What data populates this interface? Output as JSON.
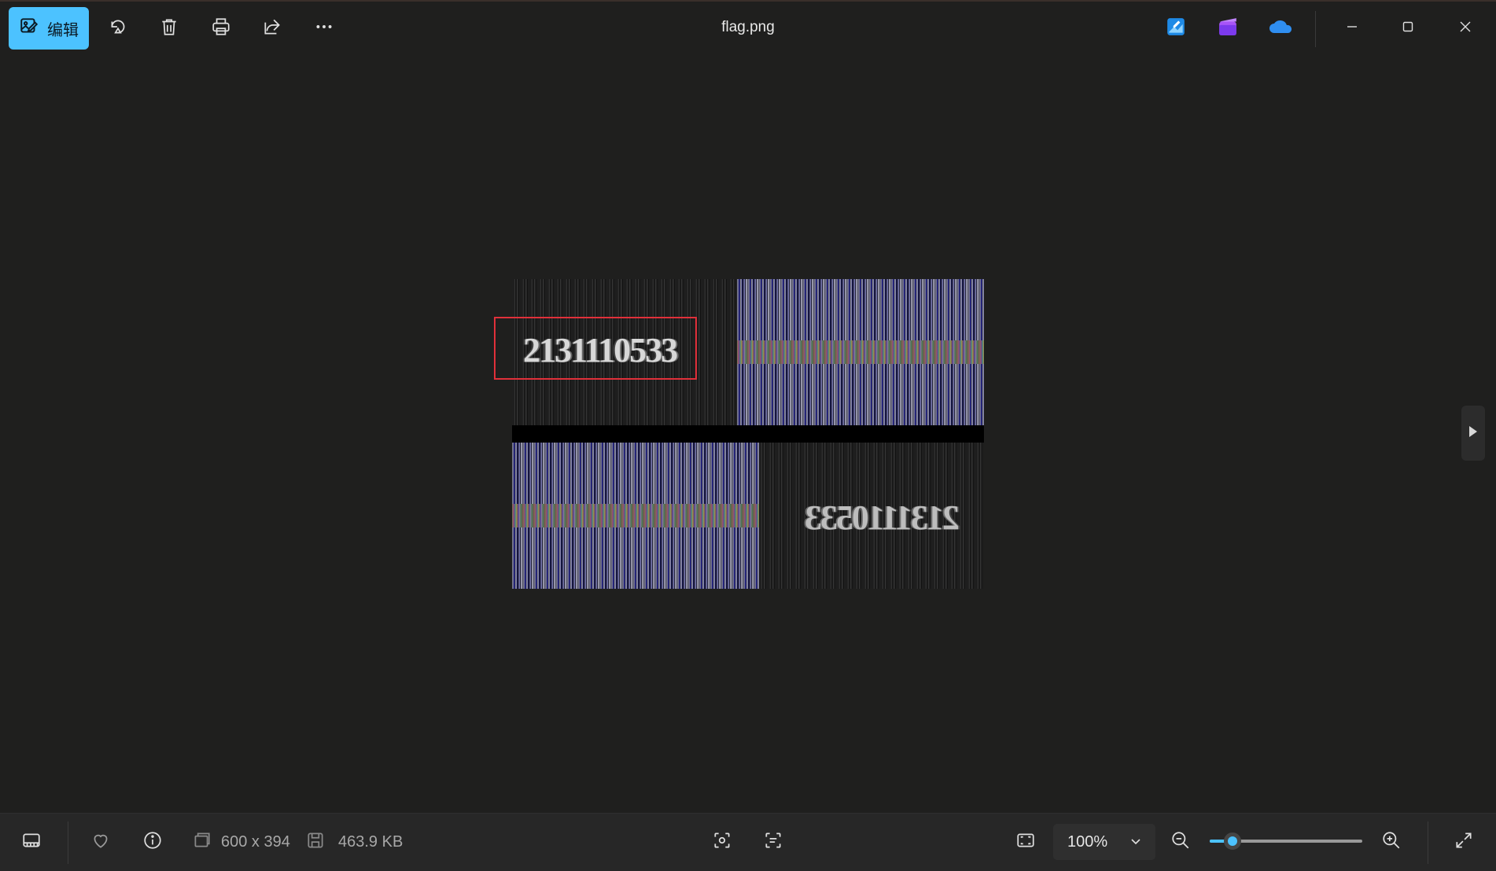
{
  "window": {
    "title": "flag.png"
  },
  "toolbar": {
    "edit_label": "编辑",
    "icons": [
      "edit-icon",
      "rotate-icon",
      "delete-icon",
      "print-icon",
      "share-icon",
      "more-icon"
    ],
    "apps": [
      "image-creator-icon",
      "clipchamp-icon",
      "onedrive-icon"
    ]
  },
  "image": {
    "digits_top": "2131110533",
    "digits_bottom": "2131110533"
  },
  "statusbar": {
    "dimensions": "600 x 394",
    "filesize": "463.9 KB",
    "zoom_value": "100%",
    "zoom_level": 0.15
  },
  "colors": {
    "accent": "#4cc2ff",
    "background": "#1f1f1e",
    "highlight": "#e0303a"
  }
}
